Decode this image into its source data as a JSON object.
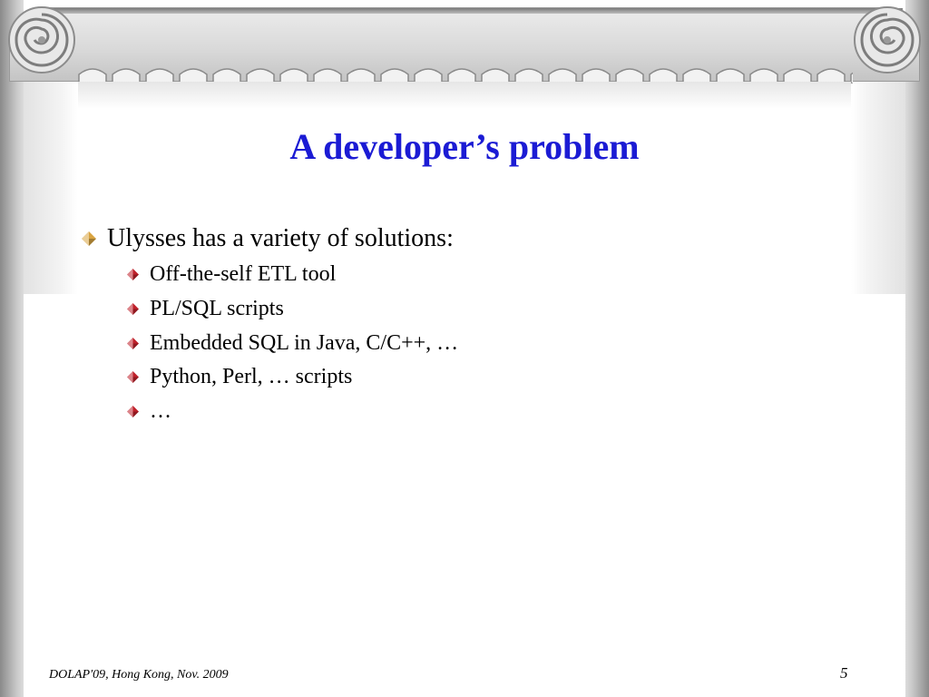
{
  "slide": {
    "title": "A developer’s problem",
    "bullets": [
      {
        "level": 1,
        "text": "Ulysses has a variety of solutions:"
      },
      {
        "level": 2,
        "text": "Off-the-self ETL tool"
      },
      {
        "level": 2,
        "text": "PL/SQL scripts"
      },
      {
        "level": 2,
        "text": "Embedded SQL in Java, C/C++, …"
      },
      {
        "level": 2,
        "text": "Python, Perl, … scripts"
      },
      {
        "level": 2,
        "text": "…"
      }
    ],
    "footer": "DOLAP'09, Hong Kong, Nov. 2009",
    "page_number": "5"
  },
  "colors": {
    "title": "#1b1bd4",
    "bullet_level1": "#d9a441",
    "bullet_level2": "#c0202a",
    "frame": "#c8c8c8"
  },
  "icons": {
    "level1_bullet": "diamond-bullet-icon",
    "level2_bullet": "diamond-bullet-icon",
    "decoration": "ionic-capital-volute"
  }
}
